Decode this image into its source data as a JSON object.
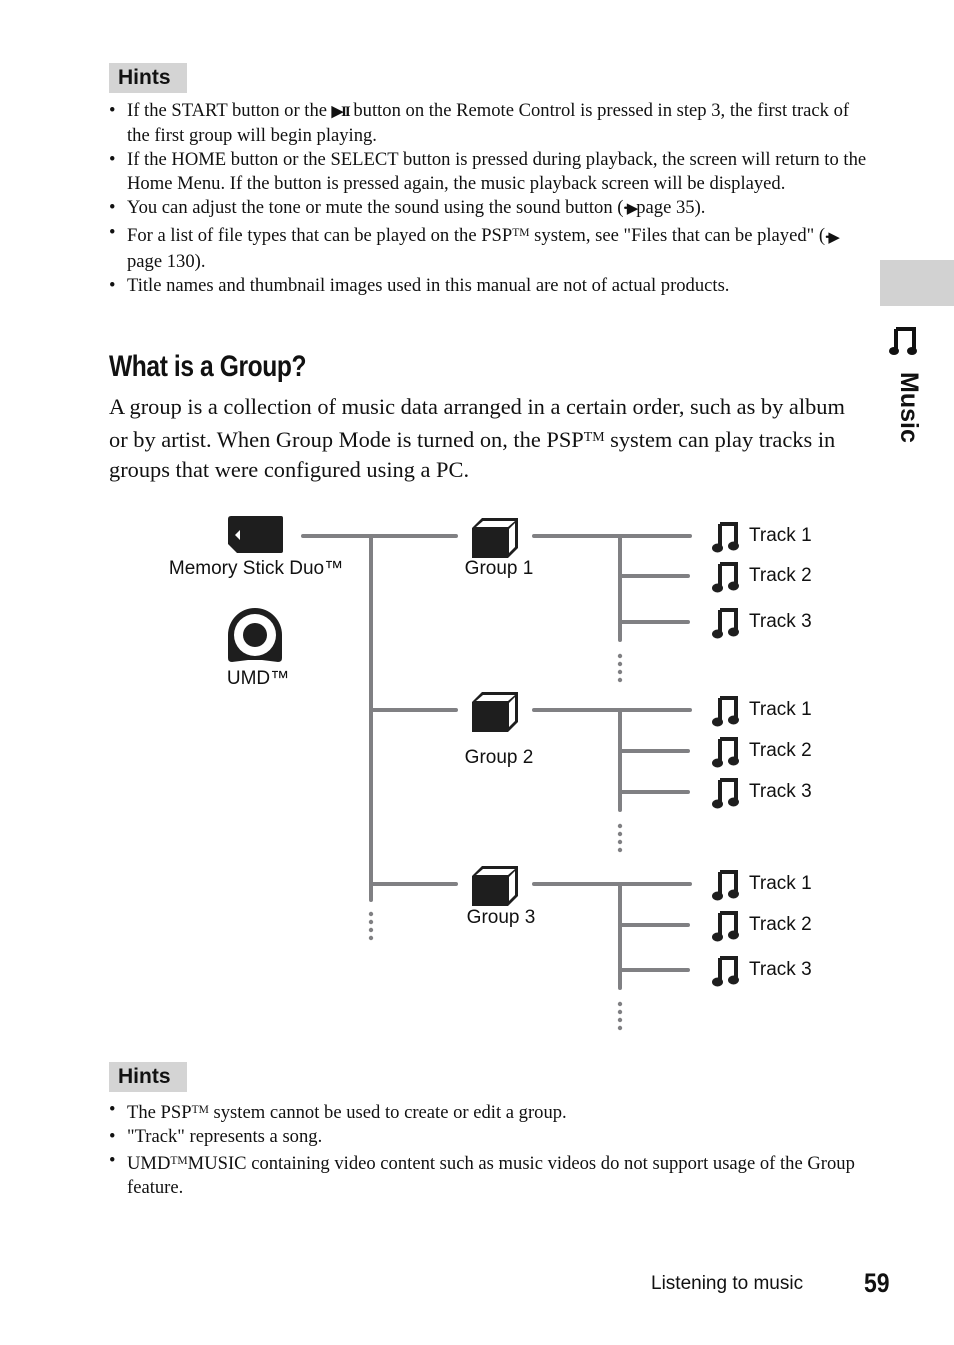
{
  "hints_top": {
    "badge": "Hints",
    "items": [
      {
        "parts": [
          "If the START button or the ",
          {
            "icon": "play-pause-icon",
            "glyph": "▶II"
          },
          " button on the Remote Control is pressed in step 3, the first track of the first group will begin playing."
        ]
      },
      {
        "parts": [
          "If the HOME button or the SELECT button is pressed during playback, the screen will return to the Home Menu. If the button is pressed again, the music playback screen will be displayed."
        ]
      },
      {
        "parts": [
          "You can adjust the tone or mute the sound using the sound button (",
          {
            "icon": "page-ref-icon",
            "glyph": "••▶"
          },
          "page 35)."
        ]
      },
      {
        "parts": [
          "For a list of file types that can be played on the PSP",
          {
            "tm": "TM"
          },
          " system, see \"Files that can be played\" (",
          {
            "icon": "page-ref-icon",
            "glyph": "••▶"
          },
          "page 130)."
        ]
      },
      {
        "parts": [
          "Title names and thumbnail images used in this manual are not of actual products."
        ]
      }
    ]
  },
  "side_tab": {
    "label": "Music",
    "icon": "music-note-icon"
  },
  "section": {
    "title": "What is a Group?",
    "body_parts": [
      "A group is a collection of music data arranged in a certain order, such as by album or by artist. When Group Mode is turned on, the PSP",
      {
        "tm": "TM"
      },
      " system can play tracks in groups that were configured using a PC."
    ]
  },
  "diagram": {
    "sources": [
      {
        "label": "Memory Stick Duo™",
        "icon": "memory-stick-icon"
      },
      {
        "label": "UMD™",
        "icon": "umd-disc-icon"
      }
    ],
    "groups": [
      {
        "label": "Group 1",
        "icon": "folder-box-icon",
        "tracks": [
          "Track 1",
          "Track 2",
          "Track 3"
        ]
      },
      {
        "label": "Group 2",
        "icon": "folder-box-icon",
        "tracks": [
          "Track 1",
          "Track 2",
          "Track 3"
        ]
      },
      {
        "label": "Group 3",
        "icon": "folder-box-icon",
        "tracks": [
          "Track 1",
          "Track 2",
          "Track 3"
        ]
      }
    ],
    "line_color": "#808083",
    "icon_color": "#1e1e1e"
  },
  "hints_bottom": {
    "badge": "Hints",
    "items": [
      {
        "parts": [
          "The PSP",
          {
            "tm": "TM"
          },
          " system cannot be used to create or edit a group."
        ]
      },
      {
        "parts": [
          "\"Track\" represents a song."
        ]
      },
      {
        "parts": [
          "UMD",
          {
            "tm": "TM"
          },
          "MUSIC containing video content such as music videos do not support usage of the Group feature."
        ]
      }
    ]
  },
  "footer": {
    "label": "Listening to music",
    "page_number": "59"
  },
  "colors": {
    "badge_bg": "#d4d4d4",
    "side_tab_bg": "#d2d2d2"
  }
}
